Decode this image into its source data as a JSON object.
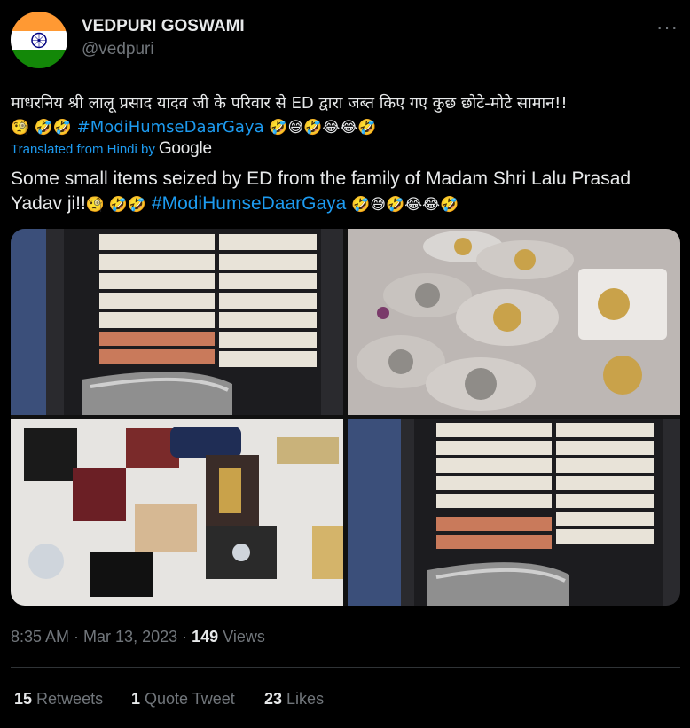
{
  "author": {
    "name": "VEDPURI GOSWAMI",
    "handle": "@vedpuri"
  },
  "tweet": {
    "hindi_text": "माधरनिय श्री लालू प्रसाद यादव जी के परिवार से ED द्वारा जब्त किए गए कुछ छोटे-मोटे सामान!!",
    "hindi_emoji_pre": "🧐 🤣🤣",
    "hashtag": "#ModiHumseDaarGaya",
    "emoji_post": "🤣😅🤣😂😂🤣",
    "translated_label": "Translated from Hindi by",
    "translator": "Google",
    "english_text": "Some small items seized by ED from the family of Madam Shri Lalu Prasad Yadav ji!!",
    "english_emoji_pre": "🧐 🤣🤣"
  },
  "meta": {
    "time": "8:35 AM",
    "date": "Mar 13, 2023",
    "views_count": "149",
    "views_label": "Views"
  },
  "stats": {
    "retweets_count": "15",
    "retweets_label": "Retweets",
    "quotes_count": "1",
    "quotes_label": "Quote Tweet",
    "likes_count": "23",
    "likes_label": "Likes"
  },
  "icons": {
    "more": "more-options-icon"
  },
  "colors": {
    "background": "#000000",
    "accent": "#1d9bf0",
    "secondary_text": "#71767b",
    "primary_text": "#e7e9ea"
  }
}
